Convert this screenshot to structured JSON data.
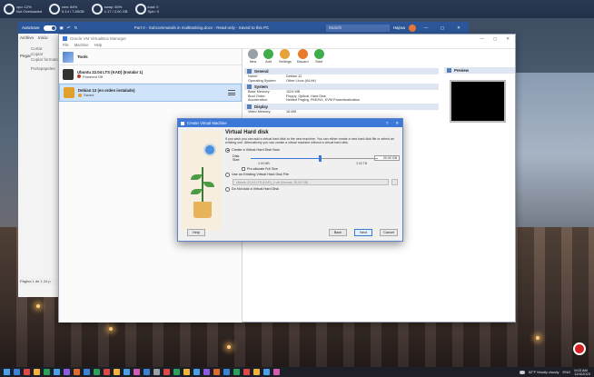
{
  "system_monitor": [
    {
      "name": "cpu",
      "value": "cpu: 12%",
      "sub": "Not Overloaded"
    },
    {
      "name": "ram",
      "value": "ram: 84%",
      "sub": "5.14 / 7.85GB"
    },
    {
      "name": "swap",
      "value": "swap: 60%",
      "sub": "1.17 / 2.00 GB"
    },
    {
      "name": "load",
      "value": "load: 0",
      "sub": "Spin: 0"
    }
  ],
  "word": {
    "autosave_label": "AutoSave",
    "autosave_state": "On",
    "title": "Part II - Subcommands in multitasking.docx - Read-only - Saved to this PC",
    "search_placeholder": "Search",
    "user": "Hajraa",
    "tabs": [
      "Archivo",
      "Inicio"
    ],
    "paste_label": "Pegar",
    "clipboard_label": "Portapapeles",
    "ribbon_items": [
      "Cortar",
      "Copiar",
      "Copiar formato"
    ],
    "status_page": "Página 1 de 1",
    "status_words": "24 p"
  },
  "vbox": {
    "title": "Oracle VM VirtualBox Manager",
    "menu": [
      "File",
      "Machine",
      "Help"
    ],
    "tools_label": "Tools",
    "vms": [
      {
        "name": "Ubuntu 22.04 LTS (KAD) (Instalar 1)",
        "state": "Powered Off",
        "state_color": "#c03a2b",
        "icon_color": "#333333",
        "selected": false
      },
      {
        "name": "Debian 12 (en orden instalado)",
        "state": "Saved",
        "state_color": "#e0a02a",
        "icon_color": "#e0a02a",
        "selected": true
      }
    ],
    "toolbar": [
      {
        "label": "New",
        "color": "#9aa0a8"
      },
      {
        "label": "Add",
        "color": "#3fae4a"
      },
      {
        "label": "Settings",
        "color": "#e8a23a"
      },
      {
        "label": "Discard",
        "color": "#e87a2a"
      },
      {
        "label": "Start",
        "color": "#3fae4a"
      }
    ],
    "sections": [
      {
        "title": "General",
        "rows": [
          [
            "Name:",
            "Debian 12"
          ],
          [
            "Operating System:",
            "Other Linux (64-bit)"
          ]
        ]
      },
      {
        "title": "System",
        "rows": [
          [
            "Base Memory:",
            "1024 MB"
          ],
          [
            "Boot Order:",
            "Floppy, Optical, Hard Disk"
          ],
          [
            "Acceleration:",
            "Nested Paging, PAE/NX, KVM Paravirtualization"
          ]
        ]
      },
      {
        "title": "Display",
        "rows": [
          [
            "Video Memory:",
            "16 MB"
          ]
        ]
      }
    ],
    "preview_label": "Preview"
  },
  "dialog": {
    "title": "Create Virtual Machine",
    "heading": "Virtual Hard disk",
    "description": "If you wish you can add a virtual hard disk to the new machine. You can either create a new hard disk file or select an existing one. Alternatively you can create a virtual machine without a virtual hard disk.",
    "options": [
      "Create a Virtual Hard Disk Now",
      "Use an Existing Virtual Hard Disk File",
      "Do Not Add a Virtual Hard Disk"
    ],
    "selected_option": 0,
    "disk_size_label": "Disk Size:",
    "disk_size_value": "20.00 GB",
    "slider_fraction": 0.55,
    "slider_min": "4.00 MB",
    "slider_max": "2.00 TB",
    "preallocate_label": "Pre-allocate Full Size",
    "existing_file_value": "Ubuntu 22.04 LTS (KAD)_1.vdi (Normal, 25.00 GB)",
    "buttons": {
      "help": "Help",
      "back": "Back",
      "next": "Next",
      "cancel": "Cancel"
    }
  },
  "taskbar": {
    "icons": [
      "#3b82d6",
      "#e04848",
      "#f0b33b",
      "#2aa05a",
      "#4aa0e8",
      "#8a5ae0",
      "#e06a2a",
      "#3b82d6",
      "#2aa05a",
      "#e04848",
      "#f0b33b",
      "#4aa0e8",
      "#d45ab0",
      "#3b82d6",
      "#9aa0a8",
      "#e04848",
      "#2aa05a",
      "#f0b33b",
      "#4aa0e8",
      "#8a5ae0",
      "#e06a2a",
      "#3b82d6",
      "#2aa05a",
      "#e04848",
      "#f0b33b",
      "#4aa0e8",
      "#d45ab0"
    ],
    "weather": "52°F Mostly cloudy",
    "time": "9:03 AM",
    "date": "12/4/2023",
    "lang": "ENG"
  }
}
